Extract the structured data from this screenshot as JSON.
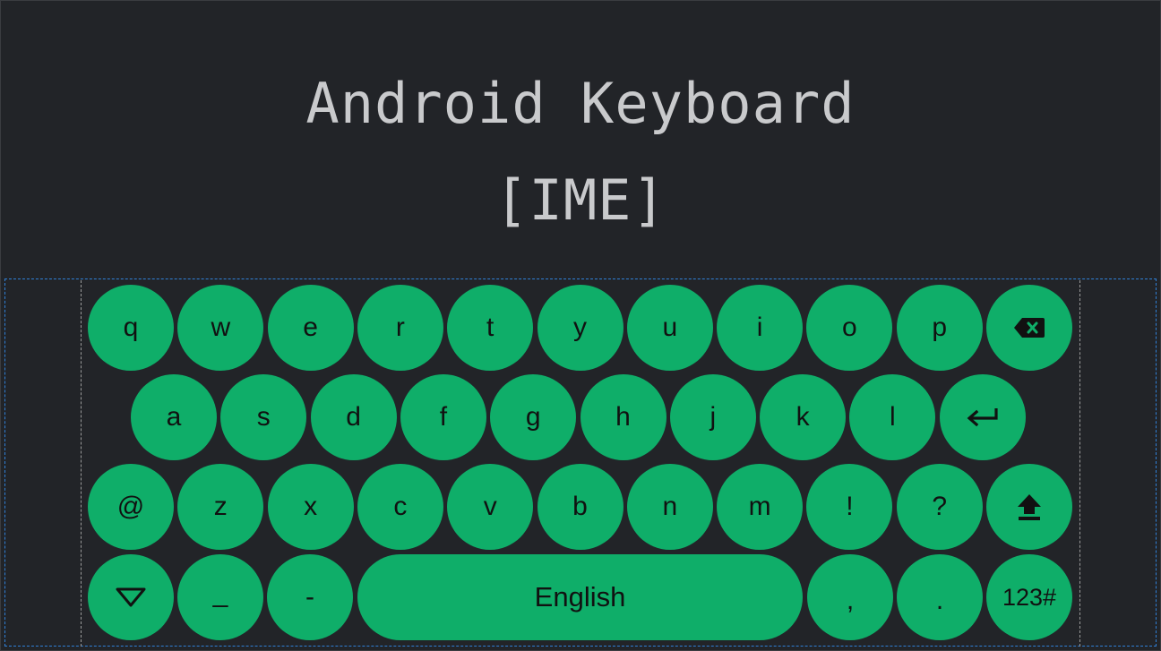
{
  "header": {
    "title_line1": "Android Keyboard",
    "title_line2": "[IME]"
  },
  "colors": {
    "background": "#222428",
    "key": "#0fae69",
    "key_text": "#111111",
    "title": "#c9cacc",
    "ime_outline": "#2f7fd6"
  },
  "keyboard": {
    "rows": [
      {
        "keys": [
          {
            "label": "q",
            "name": "key-q"
          },
          {
            "label": "w",
            "name": "key-w"
          },
          {
            "label": "e",
            "name": "key-e"
          },
          {
            "label": "r",
            "name": "key-r"
          },
          {
            "label": "t",
            "name": "key-t"
          },
          {
            "label": "y",
            "name": "key-y"
          },
          {
            "label": "u",
            "name": "key-u"
          },
          {
            "label": "i",
            "name": "key-i"
          },
          {
            "label": "o",
            "name": "key-o"
          },
          {
            "label": "p",
            "name": "key-p"
          },
          {
            "label": "",
            "name": "backspace-key",
            "icon": "backspace-icon"
          }
        ]
      },
      {
        "keys": [
          {
            "label": "a",
            "name": "key-a"
          },
          {
            "label": "s",
            "name": "key-s"
          },
          {
            "label": "d",
            "name": "key-d"
          },
          {
            "label": "f",
            "name": "key-f"
          },
          {
            "label": "g",
            "name": "key-g"
          },
          {
            "label": "h",
            "name": "key-h"
          },
          {
            "label": "j",
            "name": "key-j"
          },
          {
            "label": "k",
            "name": "key-k"
          },
          {
            "label": "l",
            "name": "key-l"
          },
          {
            "label": "",
            "name": "enter-key",
            "icon": "enter-icon"
          }
        ]
      },
      {
        "keys": [
          {
            "label": "@",
            "name": "key-at"
          },
          {
            "label": "z",
            "name": "key-z"
          },
          {
            "label": "x",
            "name": "key-x"
          },
          {
            "label": "c",
            "name": "key-c"
          },
          {
            "label": "v",
            "name": "key-v"
          },
          {
            "label": "b",
            "name": "key-b"
          },
          {
            "label": "n",
            "name": "key-n"
          },
          {
            "label": "m",
            "name": "key-m"
          },
          {
            "label": "!",
            "name": "key-exclamation"
          },
          {
            "label": "?",
            "name": "key-question"
          },
          {
            "label": "",
            "name": "shift-key",
            "icon": "shift-icon"
          }
        ]
      },
      {
        "keys": [
          {
            "label": "",
            "name": "hide-keyboard-key",
            "icon": "chevron-down-icon"
          },
          {
            "label": "_",
            "name": "key-underscore"
          },
          {
            "label": "-",
            "name": "key-hyphen"
          },
          {
            "label": "English",
            "name": "space-key"
          },
          {
            "label": ",",
            "name": "key-comma"
          },
          {
            "label": ".",
            "name": "key-period"
          },
          {
            "label": "123#",
            "name": "symbols-key"
          }
        ]
      }
    ]
  }
}
